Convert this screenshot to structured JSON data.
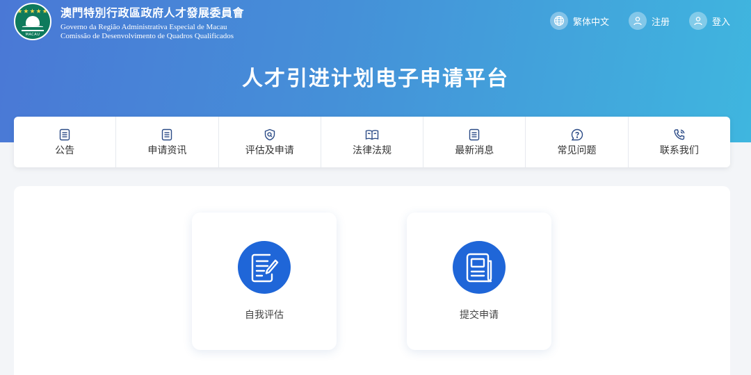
{
  "header": {
    "org_name_cn": "澳門特別行政區政府人才發展委員會",
    "org_name_pt_line1": "Governo da Região Administrativa Especial de Macau",
    "org_name_pt_line2": "Comissão de Desenvolvimento de Quadros Qualificados",
    "logo_text": "MACAU",
    "links": {
      "language": "繁体中文",
      "register": "注册",
      "login": "登入"
    },
    "platform_title": "人才引进计划电子申请平台"
  },
  "nav": {
    "items": [
      {
        "label": "公告",
        "icon": "document-icon"
      },
      {
        "label": "申请资讯",
        "icon": "document-icon"
      },
      {
        "label": "评估及申请",
        "icon": "shield-search-icon"
      },
      {
        "label": "法律法规",
        "icon": "open-book-icon"
      },
      {
        "label": "最新消息",
        "icon": "document-icon"
      },
      {
        "label": "常见问题",
        "icon": "question-icon"
      },
      {
        "label": "联系我们",
        "icon": "phone-icon"
      }
    ]
  },
  "cards": [
    {
      "label": "自我评估",
      "icon": "edit-document-icon"
    },
    {
      "label": "提交申请",
      "icon": "newspaper-icon"
    }
  ],
  "colors": {
    "hero_start": "#4a78d6",
    "hero_end": "#3fb6df",
    "card_icon_bg": "#1f66d8",
    "nav_icon": "#2a4a86"
  }
}
